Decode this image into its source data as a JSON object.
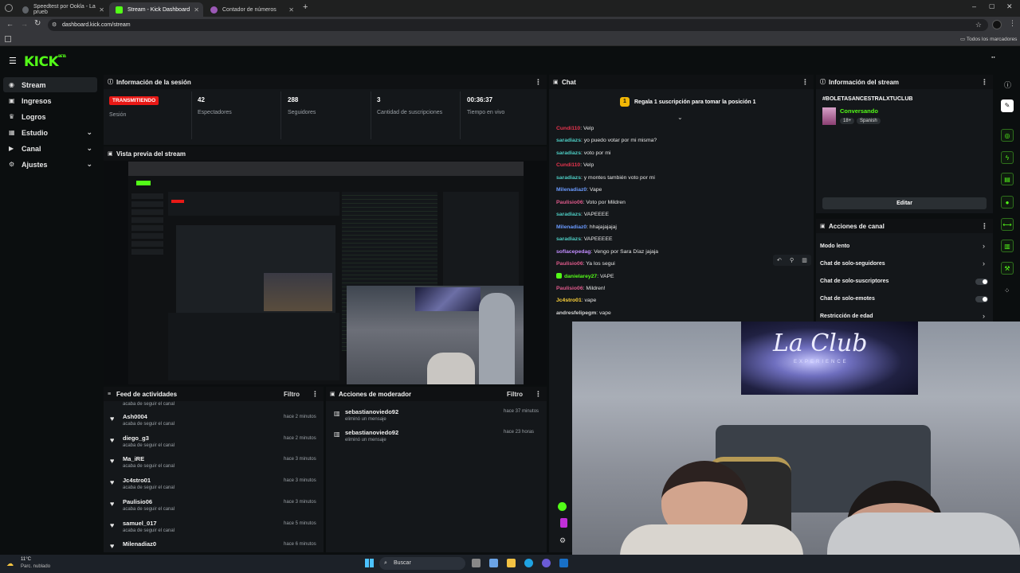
{
  "browser": {
    "tabs": [
      {
        "title": "Speedtest por Ookla - La prueb",
        "active": false,
        "color": "#5f6368"
      },
      {
        "title": "Stream - Kick Dashboard",
        "active": true,
        "color": "#53fc18"
      },
      {
        "title": "Contador de números",
        "active": false,
        "color": "#9b59b6"
      }
    ],
    "url": "dashboard.kick.com/stream",
    "bookmarks_label": "Todos los marcadores"
  },
  "brand": {
    "logo": "KICK",
    "logo_sup": "BETA",
    "accent": "#53fc18"
  },
  "sidebar": {
    "items": [
      {
        "label": "Stream",
        "icon": "stream-icon",
        "active": true
      },
      {
        "label": "Ingresos",
        "icon": "money-icon"
      },
      {
        "label": "Logros",
        "icon": "trophy-icon"
      },
      {
        "label": "Estudio",
        "icon": "studio-icon"
      },
      {
        "label": "Canal",
        "icon": "channel-icon"
      },
      {
        "label": "Ajustes",
        "icon": "gear-icon"
      }
    ]
  },
  "session": {
    "title": "Información de la sesión",
    "status": "TRANSMITIENDO",
    "status_label": "Sesión",
    "stats": [
      {
        "value": "42",
        "label": "Espectadores"
      },
      {
        "value": "288",
        "label": "Seguidores"
      },
      {
        "value": "3",
        "label": "Cantidad de suscripciones"
      },
      {
        "value": "00:36:37",
        "label": "Tiempo en vivo"
      }
    ]
  },
  "preview": {
    "title": "Vista previa del stream"
  },
  "feed": {
    "title": "Feed de actividades",
    "filter": "Filtro",
    "cut_text": "acaba de seguir el canal",
    "items": [
      {
        "name": "Ash0004",
        "sub": "acaba de seguir el canal",
        "time": "hace 2 minutos"
      },
      {
        "name": "diego_g3",
        "sub": "acaba de seguir el canal",
        "time": "hace 2 minutos"
      },
      {
        "name": "Ma_iRE",
        "sub": "acaba de seguir el canal",
        "time": "hace 3 minutos"
      },
      {
        "name": "Jc4stro01",
        "sub": "acaba de seguir el canal",
        "time": "hace 3 minutos"
      },
      {
        "name": "Paulisio06",
        "sub": "acaba de seguir el canal",
        "time": "hace 3 minutos"
      },
      {
        "name": "samuel_017",
        "sub": "acaba de seguir el canal",
        "time": "hace 5 minutos"
      },
      {
        "name": "Milenadiaz0",
        "sub": "",
        "time": "hace 6 minutos"
      }
    ]
  },
  "mod": {
    "title": "Acciones de moderador",
    "filter": "Filtro",
    "items": [
      {
        "name": "sebastianoviedo92",
        "sub": "eliminó un mensaje",
        "time": "hace 37 minutos"
      },
      {
        "name": "sebastianoviedo92",
        "sub": "eliminó un mensaje",
        "time": "hace 23 horas"
      }
    ]
  },
  "chat": {
    "title": "Chat",
    "pinned": "Regala 1 suscripción para tomar la posición 1",
    "pinned_rank": "1",
    "messages": [
      {
        "user": "Cundi110",
        "text": ": Velp",
        "color": "c-red"
      },
      {
        "user": "saradiazs",
        "text": ": yo puedo votar por mi misma?",
        "color": "c-teal"
      },
      {
        "user": "saradiazs",
        "text": ": voto por mi",
        "color": "c-teal"
      },
      {
        "user": "Cundi110",
        "text": ": Velp",
        "color": "c-red"
      },
      {
        "user": "saradiazs",
        "text": ": y montes también voto por mi",
        "color": "c-teal"
      },
      {
        "user": "Milenadiaz0",
        "text": ": Vape",
        "color": "c-blue"
      },
      {
        "user": "Paulisio06",
        "text": ": Voto por Mildren",
        "color": "c-pink"
      },
      {
        "user": "saradiazs",
        "text": ": VAPEEEE",
        "color": "c-teal"
      },
      {
        "user": "Milenadiaz0",
        "text": ": hhajajajajaj",
        "color": "c-blue"
      },
      {
        "user": "saradiazs",
        "text": ": VAPEEEEE",
        "color": "c-teal"
      },
      {
        "user": "soflacepedag",
        "text": ": Vengo por Sara Díaz jajaja",
        "color": "c-violet"
      },
      {
        "user": "Paulisio06",
        "text": ": Ya los segui",
        "color": "c-pink"
      },
      {
        "user": "danielarey27",
        "text": ": VAPE",
        "color": "c-green"
      },
      {
        "user": "Paulisio06",
        "text": ": Mildren!",
        "color": "c-pink"
      },
      {
        "user": "Jc4stro01",
        "text": ": vape",
        "color": "c-yellow"
      },
      {
        "user": "andresfelipegm",
        "text": ": vape",
        "color": "c-gray"
      }
    ]
  },
  "stream_info": {
    "title": "Información del stream",
    "stream_title": "#BOLETASANCESTRALXTUCLUB",
    "category": "Conversando",
    "tags": [
      "18+",
      "Spanish"
    ],
    "edit": "Editar"
  },
  "channel_actions": {
    "title": "Acciones de canal",
    "items": [
      {
        "label": "Modo lento",
        "control": "chevron"
      },
      {
        "label": "Chat de solo-seguidores",
        "control": "chevron"
      },
      {
        "label": "Chat de solo-suscriptores",
        "control": "toggle"
      },
      {
        "label": "Chat de solo-emotes",
        "control": "toggle"
      },
      {
        "label": "Restricción de edad",
        "control": "chevron"
      }
    ]
  },
  "webcam": {
    "sign_text": "La Club",
    "sign_sub": "EXPERIENCE"
  },
  "taskbar": {
    "weather_temp": "11°C",
    "weather_desc": "Parc. nublado",
    "search": "Buscar"
  }
}
